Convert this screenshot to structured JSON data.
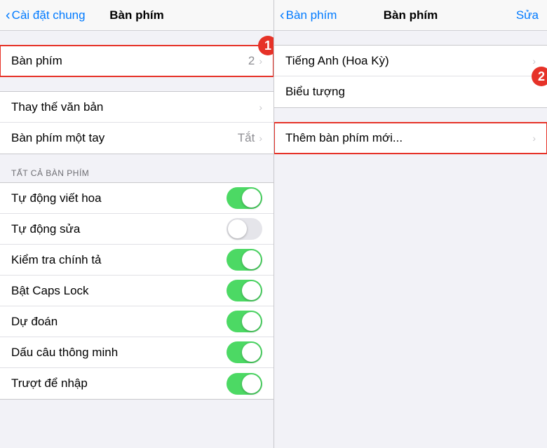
{
  "panel1": {
    "nav": {
      "back_label": "Cài đặt chung",
      "title": "Bàn phím"
    },
    "groups": {
      "top": {
        "rows": [
          {
            "label": "Bàn phím",
            "value": "2",
            "has_chevron": true,
            "highlighted": true,
            "badge": "1"
          }
        ]
      },
      "middle": {
        "rows": [
          {
            "label": "Thay thế văn bản",
            "value": "",
            "has_chevron": true
          },
          {
            "label": "Bàn phím một tay",
            "value": "Tắt",
            "has_chevron": true
          }
        ]
      },
      "section_header": "TẤT CẢ BÀN PHÍM",
      "toggles": [
        {
          "label": "Tự động viết hoa",
          "state": "on"
        },
        {
          "label": "Tự động sửa",
          "state": "off"
        },
        {
          "label": "Kiểm tra chính tả",
          "state": "on"
        },
        {
          "label": "Bật Caps Lock",
          "state": "on"
        },
        {
          "label": "Dự đoán",
          "state": "on"
        },
        {
          "label": "Dấu câu thông minh",
          "state": "on"
        },
        {
          "label": "Trượt để nhập",
          "state": "on"
        }
      ]
    }
  },
  "panel2": {
    "nav": {
      "back_label": "Bàn phím",
      "title": "Bàn phím",
      "action_label": "Sửa"
    },
    "top_rows": [
      {
        "label": "Tiếng Anh (Hoa Kỳ)",
        "has_chevron": true
      },
      {
        "label": "Biểu tượng",
        "has_chevron": false,
        "badge": "2"
      }
    ],
    "bottom_rows": [
      {
        "label": "Thêm bàn phím mới...",
        "has_chevron": true,
        "highlighted": true
      }
    ]
  },
  "icons": {
    "chevron": "›",
    "back_chevron": "‹"
  }
}
